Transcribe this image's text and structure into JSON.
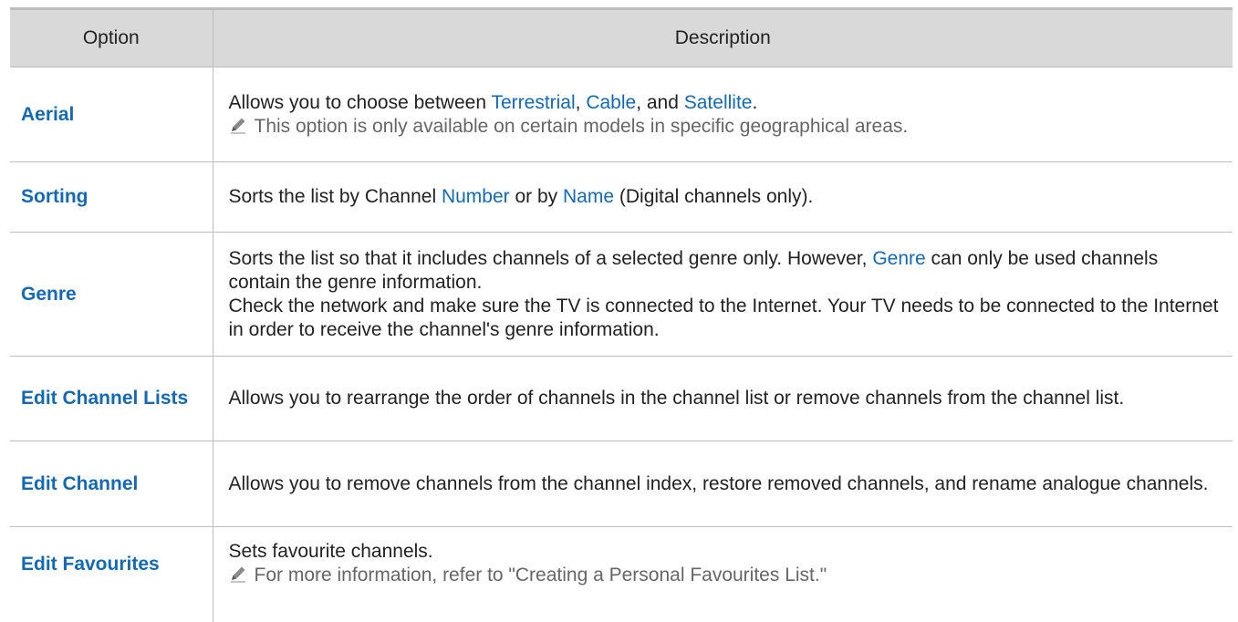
{
  "table": {
    "header": {
      "option": "Option",
      "description": "Description"
    },
    "rows": [
      {
        "option": "Aerial",
        "desc": {
          "p1": "Allows you to choose between ",
          "k1": "Terrestrial",
          "p2": ", ",
          "k2": "Cable",
          "p3": ", and ",
          "k3": "Satellite",
          "p4": "."
        },
        "note": "This option is only available on certain models in specific geographical areas."
      },
      {
        "option": "Sorting",
        "desc": {
          "p1": "Sorts the list by Channel ",
          "k1": "Number",
          "p2": " or by ",
          "k2": "Name",
          "p3": " (Digital channels only)."
        }
      },
      {
        "option": "Genre",
        "desc": {
          "p1": "Sorts the list so that it includes channels of a selected genre only. However, ",
          "k1": "Genre",
          "p2": " can only be used channels contain the genre information.",
          "p3": "Check the network and make sure the TV is connected to the Internet. Your TV needs to be connected to the Internet in order to receive the channel's genre information."
        }
      },
      {
        "option": "Edit Channel Lists",
        "desc": {
          "p1": "Allows you to rearrange the order of channels in the channel list or remove channels from the channel list."
        }
      },
      {
        "option": "Edit Channel",
        "desc": {
          "p1": "Allows you to remove channels from the channel index, restore removed channels, and rename analogue channels."
        }
      },
      {
        "option": "Edit Favourites",
        "desc": {
          "p1": "Sets favourite channels."
        },
        "note": "For more information, refer to \"Creating a Personal Favourites List.\""
      }
    ]
  }
}
